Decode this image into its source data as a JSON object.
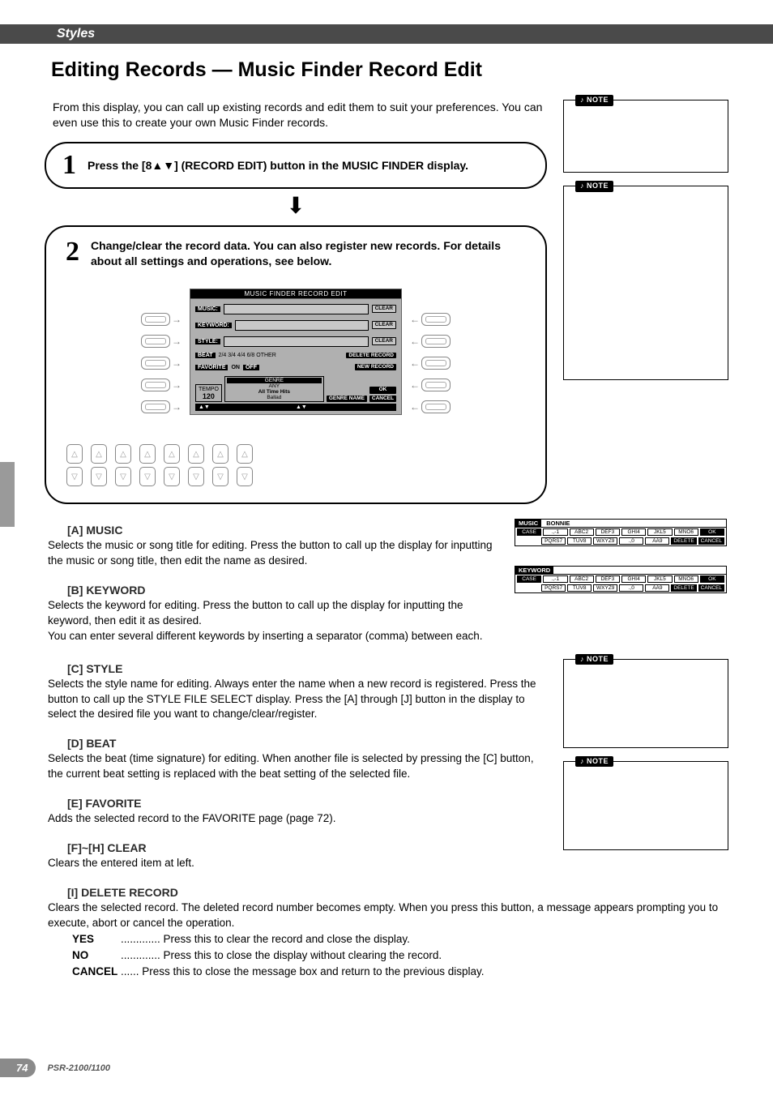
{
  "header": "Styles",
  "title": "Editing Records — Music Finder Record Edit",
  "intro": "From this display, you can call up existing records and edit them to suit your preferences. You can even use this to create your own Music Finder records.",
  "step1": {
    "num": "1",
    "text": "Press the [8▲▼] (RECORD EDIT) button in the MUSIC FINDER display."
  },
  "step2": {
    "num": "2",
    "text": "Change/clear the record data. You can also register new records. For details about all settings and operations, see below."
  },
  "lcd": {
    "title": "MUSIC FINDER RECORD EDIT",
    "rows": {
      "music": "MUSIC:",
      "keyword": "KEYWORD:",
      "style": "STYLE:",
      "beat_opts": "2/4 3/4 4/4 6/8 OTHER",
      "beat_label": "BEAT",
      "favorite": "FAVORITE",
      "fav_on": "ON",
      "fav_off": "OFF"
    },
    "right_btns": {
      "clear": "CLEAR",
      "delete_record": "DELETE RECORD",
      "new_record": "NEW RECORD",
      "ok": "OK",
      "cancel": "CANCEL"
    },
    "tempo_label": "TEMPO",
    "tempo_value": "120",
    "genre_label": "GENRE",
    "genre1": "ANY",
    "genre2": "All Time Hits",
    "genre3": "Ballad",
    "genre_name_btn": "GENRE NAME",
    "footer_left": "▲▼",
    "footer_mid": "▲▼"
  },
  "sections": {
    "a": {
      "h": "[A] MUSIC",
      "p": "Selects the music or song title for editing. Press the button to call up the display for inputting the music or song title, then edit the name as desired."
    },
    "b": {
      "h": "[B] KEYWORD",
      "p1": "Selects the keyword for editing. Press the button to call up the display for inputting the keyword, then edit it as desired.",
      "p2": "You can enter several different keywords by inserting a separator (comma) between each."
    },
    "c": {
      "h": "[C] STYLE",
      "p": "Selects the style name for editing. Always enter the name when a new record is registered. Press the button to call up the STYLE FILE SELECT display. Press the [A] through [J] button in the display to select the desired file you want to change/clear/register."
    },
    "d": {
      "h": "[D] BEAT",
      "p": "Selects the beat (time signature) for editing. When another file is selected by pressing the [C] button, the current beat setting is replaced with the beat setting of the selected file."
    },
    "e": {
      "h": "[E] FAVORITE",
      "p": "Adds the selected record to the FAVORITE page (page 72)."
    },
    "fh": {
      "h": "[F]~[H] CLEAR",
      "p": "Clears the entered item at left."
    },
    "i": {
      "h": "[I] DELETE RECORD",
      "p": "Clears the selected record. The deleted record number becomes empty. When you press this button, a message appears prompting you to execute, abort or cancel the operation.",
      "yes_l": "YES",
      "yes_t": "............. Press this to clear the record and close the display.",
      "no_l": "NO",
      "no_t": "............. Press this to close the display without clearing the record.",
      "cancel_l": "CANCEL",
      "cancel_t": "...... Press this to close the message box and return to the previous display."
    }
  },
  "kbd_music": {
    "title": "MUSIC",
    "value": "BONNIE",
    "case_label": "CASE",
    "row1": [
      ".,-1",
      "ABC2",
      "DEF3",
      "GHI4",
      "JKL5",
      "MNO6",
      "OK"
    ],
    "row2": [
      "PQRS7",
      "TUV8",
      "WXYZ9",
      ".,0",
      "ÀÁ9",
      "DELETE",
      "CANCEL"
    ]
  },
  "kbd_keyword": {
    "title": "KEYWORD",
    "value": "",
    "case_label": "CASE",
    "row1": [
      ".,-1",
      "ABC2",
      "DEF3",
      "GHI4",
      "JKL5",
      "MNO6",
      "OK"
    ],
    "row2": [
      "PQRS7",
      "TUV8",
      "WXYZ9",
      ".,0",
      "ÀÁ9",
      "DELETE",
      "CANCEL"
    ]
  },
  "note_label": "NOTE",
  "footer": {
    "page": "74",
    "model": "PSR-2100/1100"
  }
}
